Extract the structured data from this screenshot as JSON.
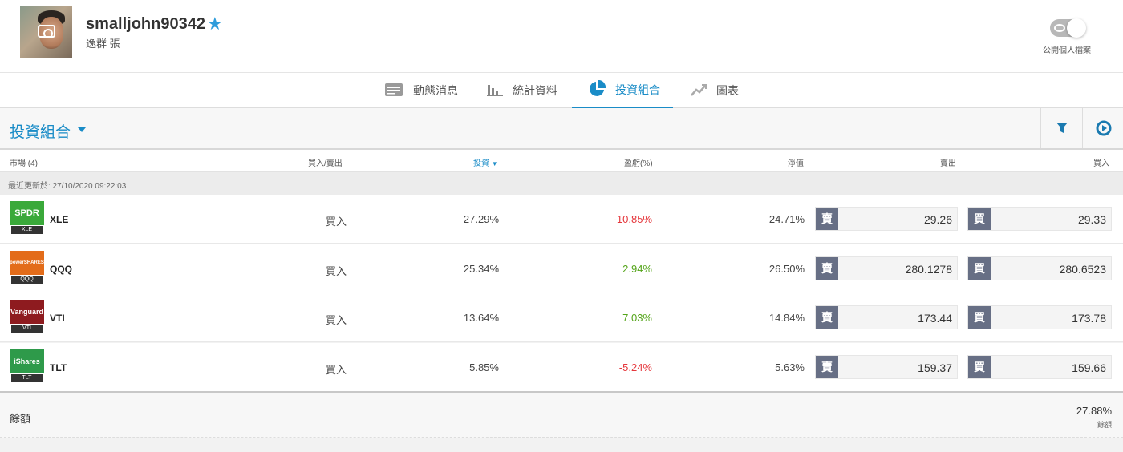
{
  "profile": {
    "username": "smalljohn90342",
    "real_name": "逸群 張",
    "public_toggle_label": "公開個人檔案"
  },
  "tabs": [
    {
      "label": "動態消息",
      "icon": "news-feed-icon"
    },
    {
      "label": "統計資料",
      "icon": "bar-stats-icon"
    },
    {
      "label": "投資組合",
      "icon": "pie-chart-icon",
      "active": true
    },
    {
      "label": "圖表",
      "icon": "trend-chart-icon"
    }
  ],
  "portfolio": {
    "title": "投資組合",
    "filter_icon": "filter-icon",
    "refresh_icon": "play-circle-icon"
  },
  "table": {
    "headers": {
      "market": "市場 (4)",
      "direction": "買入/賣出",
      "invested": "投資",
      "pl": "盈虧(%)",
      "value": "淨值",
      "sell": "賣出",
      "buy": "買入"
    },
    "updated": "最近更新於: 27/10/2020 09:22:03",
    "trade_button": "賣",
    "buy_button": "買",
    "rows": [
      {
        "symbol": "XLE",
        "logo_top": "SPDR",
        "logo_bottom": "XLE",
        "logo_color": "#3aa93a",
        "direction": "買入",
        "invested": "27.29%",
        "pl": "-10.85%",
        "pl_sign": "neg",
        "value": "24.71%",
        "sell": "29.26",
        "buy": "29.33"
      },
      {
        "symbol": "QQQ",
        "logo_top": "powerSHARES",
        "logo_bottom": "QQQ",
        "logo_color": "#e36c1a",
        "direction": "買入",
        "invested": "25.34%",
        "pl": "2.94%",
        "pl_sign": "pos",
        "value": "26.50%",
        "sell": "280.1278",
        "buy": "280.6523"
      },
      {
        "symbol": "VTI",
        "logo_top": "Vanguard",
        "logo_bottom": "VTI",
        "logo_color": "#8e1b1f",
        "direction": "買入",
        "invested": "13.64%",
        "pl": "7.03%",
        "pl_sign": "pos",
        "value": "14.84%",
        "sell": "173.44",
        "buy": "173.78"
      },
      {
        "symbol": "TLT",
        "logo_top": "iShares",
        "logo_bottom": "TLT",
        "logo_color": "#2e9a4a",
        "direction": "買入",
        "invested": "5.85%",
        "pl": "-5.24%",
        "pl_sign": "neg",
        "value": "5.63%",
        "sell": "159.37",
        "buy": "159.66"
      }
    ]
  },
  "footer": {
    "label": "餘額",
    "value": "27.88%",
    "sub": "餘額"
  }
}
